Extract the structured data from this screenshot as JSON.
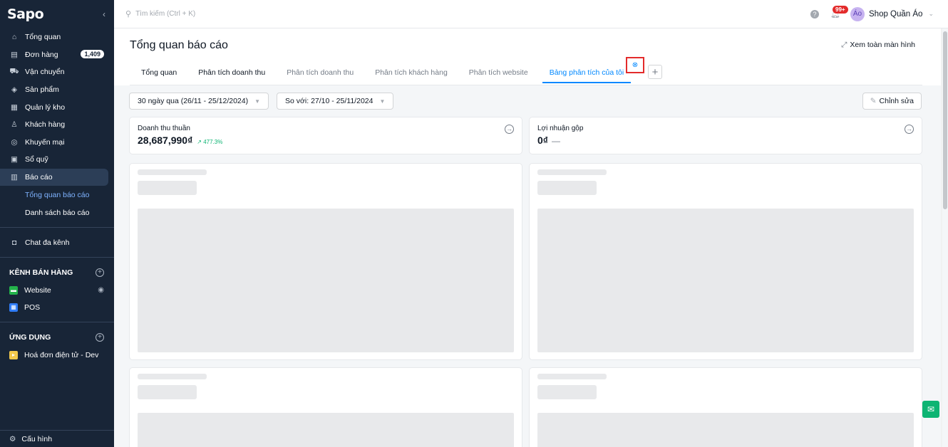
{
  "sidebar": {
    "logo": "Sapo",
    "collapse_icon": "‹",
    "items": [
      {
        "label": "Tổng quan",
        "icon": "⌂"
      },
      {
        "label": "Đơn hàng",
        "icon": "▤",
        "badge": "1,409"
      },
      {
        "label": "Vận chuyển",
        "icon": "⛟"
      },
      {
        "label": "Sản phẩm",
        "icon": "◈"
      },
      {
        "label": "Quản lý kho",
        "icon": "▦"
      },
      {
        "label": "Khách hàng",
        "icon": "♙"
      },
      {
        "label": "Khuyến mại",
        "icon": "◎"
      },
      {
        "label": "Sổ quỹ",
        "icon": "▣"
      },
      {
        "label": "Báo cáo",
        "icon": "▥"
      }
    ],
    "sub_items": [
      "Tổng quan báo cáo",
      "Danh sách báo cáo"
    ],
    "chat": {
      "label": "Chat đa kênh",
      "icon": "◘"
    },
    "sales_channels": {
      "title": "KÊNH BÁN HÀNG",
      "items": [
        {
          "label": "Website",
          "color": "#24b34b"
        },
        {
          "label": "POS",
          "color": "#2f7cf6"
        }
      ]
    },
    "apps": {
      "title": "ỨNG DỤNG",
      "items": [
        {
          "label": "Hoá đơn điện tử - Dev",
          "color": "#f2c94c"
        }
      ]
    },
    "bottom": {
      "label": "Cấu hình",
      "icon": "⚙"
    }
  },
  "topbar": {
    "search_placeholder": "Tìm kiếm (Ctrl + K)",
    "notif_count": "99+",
    "avatar_text": "Áo",
    "shop_name": "Shop Quần Áo"
  },
  "main": {
    "title": "Tổng quan báo cáo",
    "fullscreen_label": "Xem toàn màn hình",
    "tabs": [
      {
        "label": "Tổng quan"
      },
      {
        "label": "Phân tích doanh thu"
      },
      {
        "label": "Phân tích doanh thu"
      },
      {
        "label": "Phân tích khách hàng"
      },
      {
        "label": "Phân tích website"
      },
      {
        "label": "Bảng phân tích của tôi"
      }
    ],
    "filters": {
      "range": "30 ngày qua (26/11 - 25/12/2024)",
      "compare": "So với: 27/10 - 25/11/2024"
    },
    "edit_label": "Chỉnh sửa",
    "metrics": [
      {
        "label": "Doanh thu thuần",
        "value": "28,687,990₫",
        "trend": "↗ 477.3%"
      },
      {
        "label": "Lợi nhuận gộp",
        "value": "0₫",
        "trend": "—"
      }
    ]
  },
  "colors": {
    "accent": "#0088ff",
    "sidebar_bg": "#182537",
    "success": "#0db473",
    "danger": "#e32b2b"
  }
}
